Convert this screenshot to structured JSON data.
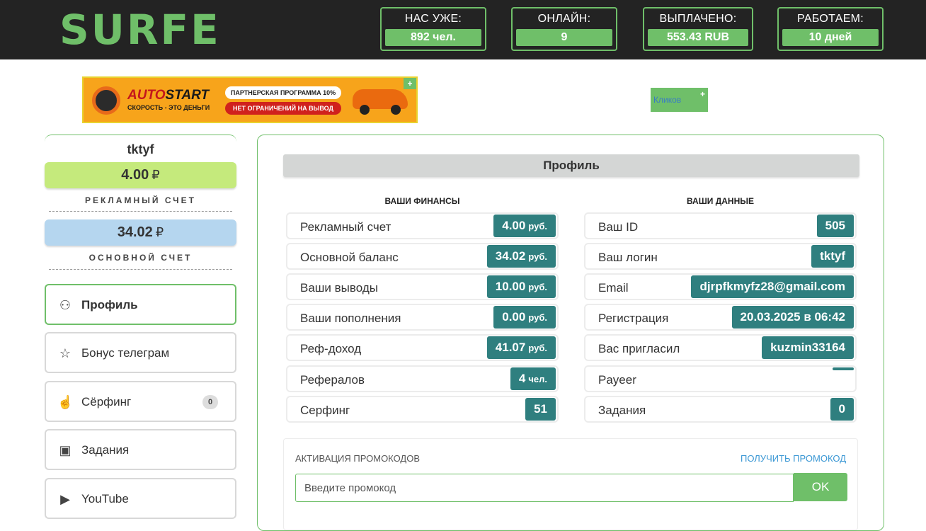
{
  "header": {
    "logo": "SURFE",
    "stats": [
      {
        "label": "НАС УЖЕ:",
        "value": "892 чел."
      },
      {
        "label": "ОНЛАЙН:",
        "value": "9"
      },
      {
        "label": "ВЫПЛАЧЕНО:",
        "value": "553.43 RUB"
      },
      {
        "label": "РАБОТАЕМ:",
        "value": "10 дней"
      }
    ]
  },
  "banners": {
    "autostart": {
      "brand_a": "AUTO",
      "brand_b": "START",
      "tagline": "СКОРОСТЬ - ЭТО ДЕНЬГИ",
      "pill1": "ПАРТНЕРСКАЯ ПРОГРАММА 10%",
      "pill2": "НЕТ ОГРАНИЧЕНИЙ НА ВЫВОД",
      "plus": "+"
    },
    "second": {
      "alt": "Кликов",
      "plus": "+"
    }
  },
  "sidebar": {
    "username": "tktyf",
    "ad_balance": {
      "amount": "4.00",
      "currency": "₽",
      "label": "РЕКЛАМНЫЙ СЧЕТ"
    },
    "main_balance": {
      "amount": "34.02",
      "currency": "₽",
      "label": "ОСНОВНОЙ СЧЕТ"
    },
    "nav": [
      {
        "label": "Профиль",
        "icon": "user-icon",
        "glyph": "⚇",
        "active": true
      },
      {
        "label": "Бонус телеграм",
        "icon": "star-icon",
        "glyph": "☆"
      },
      {
        "label": "Сёрфинг",
        "icon": "hand-pointer-icon",
        "glyph": "☝",
        "count": "0"
      },
      {
        "label": "Задания",
        "icon": "book-icon",
        "glyph": "▣"
      },
      {
        "label": "YouTube",
        "icon": "youtube-icon",
        "glyph": "▶"
      }
    ]
  },
  "main": {
    "title": "Профиль",
    "finances": {
      "heading": "ВАШИ ФИНАНСЫ",
      "rows": [
        {
          "label": "Рекламный счет",
          "value": "4.00",
          "unit": "руб."
        },
        {
          "label": "Основной баланс",
          "value": "34.02",
          "unit": "руб."
        },
        {
          "label": "Ваши выводы",
          "value": "10.00",
          "unit": "руб."
        },
        {
          "label": "Ваши пополнения",
          "value": "0.00",
          "unit": "руб."
        },
        {
          "label": "Реф-доход",
          "value": "41.07",
          "unit": "руб."
        },
        {
          "label": "Рефералов",
          "value": "4",
          "unit": "чел."
        },
        {
          "label": "Серфинг",
          "value": "51",
          "unit": ""
        }
      ]
    },
    "data": {
      "heading": "ВАШИ ДАННЫЕ",
      "rows": [
        {
          "label": "Ваш ID",
          "value": "505"
        },
        {
          "label": "Ваш логин",
          "value": "tktyf"
        },
        {
          "label": "Email",
          "value": "djrpfkmyfz28@gmail.com"
        },
        {
          "label": "Регистрация",
          "value": "20.03.2025 в 06:42"
        },
        {
          "label": "Вас пригласил",
          "value": "kuzmin33164"
        },
        {
          "label": "Payeer",
          "value": ""
        },
        {
          "label": "Задания",
          "value": "0"
        }
      ]
    },
    "promo": {
      "heading": "АКТИВАЦИЯ ПРОМОКОДОВ",
      "get_link": "ПОЛУЧИТЬ ПРОМОКОД",
      "placeholder": "Введите промокод",
      "button": "OK"
    }
  }
}
